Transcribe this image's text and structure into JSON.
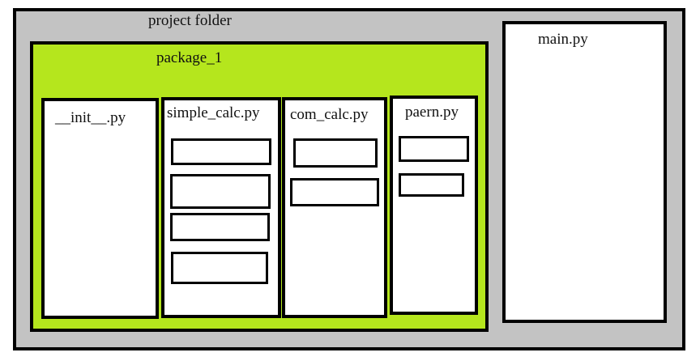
{
  "project_folder": {
    "label": "project folder",
    "background_color": "#c3c3c3"
  },
  "package": {
    "label": "package_1",
    "background_color": "#b5e61d"
  },
  "files": {
    "init": {
      "label": "__init__.py",
      "function_count": 0
    },
    "simple_calc": {
      "label": "simple_calc.py",
      "function_count": 4
    },
    "com_calc": {
      "label": "com_calc.py",
      "function_count": 2
    },
    "paern": {
      "label": "paern.py",
      "function_count": 2
    },
    "main": {
      "label": "main.py",
      "function_count": 0
    }
  }
}
